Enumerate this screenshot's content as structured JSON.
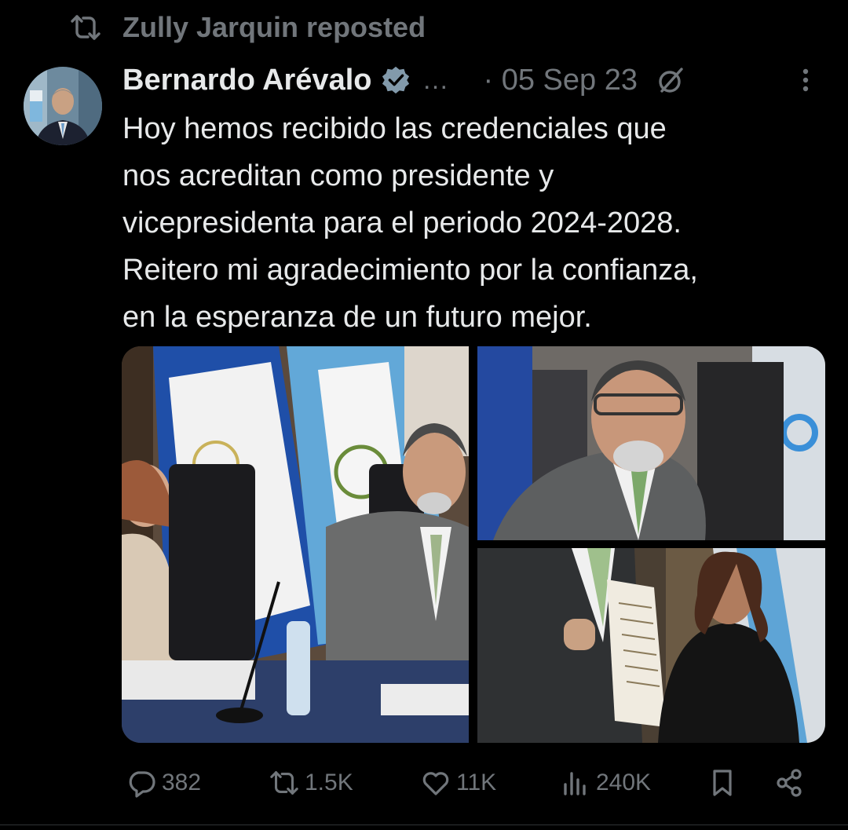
{
  "repost": {
    "text": "Zully Jarquin reposted",
    "icon": "repost-icon"
  },
  "author": {
    "name": "Bernardo Arévalo",
    "verified": true,
    "name_overflow": "…",
    "timestamp": "· 05 Sep 23"
  },
  "tweet": {
    "lines": [
      "Hoy hemos recibido las credenciales que",
      "nos acreditan como presidente y",
      "vicepresidenta para el periodo 2024-2028.",
      "Reitero mi agradecimiento por la confianza,",
      "en la esperanza de un futuro mejor."
    ]
  },
  "media": [
    {
      "description_icon": "photo-ceremony-table"
    },
    {
      "description_icon": "photo-portrait-president"
    },
    {
      "description_icon": "photo-credential-presentation"
    }
  ],
  "actions": {
    "reply_count": "382",
    "repost_count": "1.5K",
    "like_count": "11K",
    "view_count": "240K"
  },
  "colors": {
    "background": "#000000",
    "text": "#e7e9ea",
    "muted": "#71767b",
    "verified": "#829aab"
  }
}
